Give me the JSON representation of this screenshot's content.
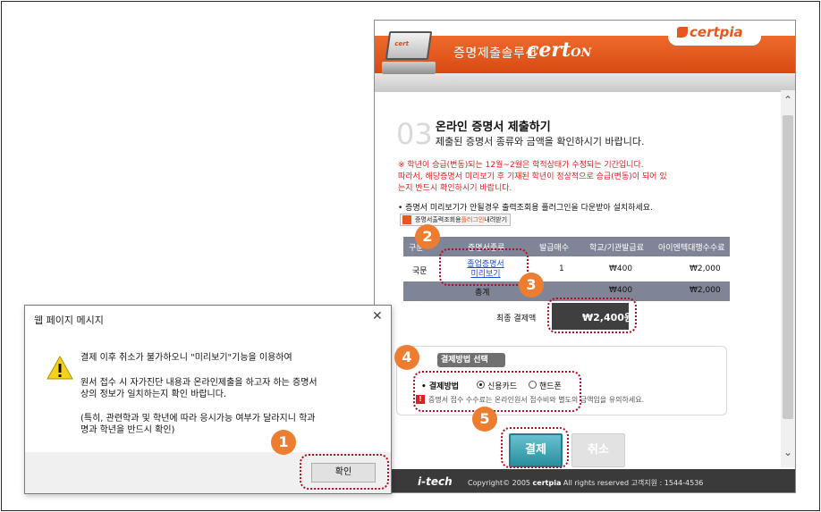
{
  "web": {
    "solution_title": "증명제출솔루션",
    "brand": "cert",
    "brand_b": "ON",
    "cp_logo": "certpia",
    "step_number": "03.",
    "step_title": "온라인 증명서 제출하기",
    "step_desc": "제출된 증명서 종류와 금액을 확인하시기 바랍니다.",
    "notice_red": [
      "※ 학년이 승급(변동)되는 12월~2월은 학적상태가 수정되는 기간입니다.",
      "따라서, 해당증명서 미리보기 후 기재된 학년이 정상적으로 승급(변동)이 되어 있",
      "는지 반드시 확인하시기 바랍니다."
    ],
    "notice_install": "• 증명서 미리보기가 안될경우 출력조회용 플러그인을 다운받아 설치하세요.",
    "plugin_btn_pre": "증명서출력조회용",
    "plugin_btn_hl": "플러그인",
    "plugin_btn_post": "내려받기",
    "table": {
      "headers": [
        "구분",
        "증명서종류",
        "발급매수",
        "학교/기관발급료",
        "아이엔텍대행수수료"
      ],
      "row": {
        "type": "국문",
        "link_line1": "졸업증명서",
        "link_line2": "미리보기",
        "count": "1",
        "school_fee": "₩400",
        "agent_fee": "₩2,000"
      },
      "total": {
        "label": "총계",
        "school_fee": "₩400",
        "agent_fee": "₩2,000"
      }
    },
    "final_label": "최종 결제액",
    "final_value": "₩2,400원",
    "payment": {
      "tab": "결제방법 선택",
      "label": "• 결제방법",
      "opt1": "신용카드",
      "opt2": "핸드폰",
      "note": "증명서 접수 수수료는 온라인원서 접수비와 별도의 금액임을 유의하세요."
    },
    "btn_pay": "결제",
    "btn_cancel": "취소",
    "footer_logo": "i-tech",
    "footer_copy": "Copyright© 2005",
    "footer_brand": "certpia",
    "footer_rights": "All rights reserved  고객지원 : 1544-4536"
  },
  "dialog": {
    "title": "웹 페이지 메시지",
    "line1": "결제 이후 취소가 불가하오니 \"미리보기\"기능을 이용하여",
    "line2": "원서 접수 시 자가진단 내용과 온라인제출을 하고자 하는 증명서",
    "line3": "상의 정보가 일치하는지 확인 바랍니다.",
    "line4": "(특히, 관련학과 및 학년에 따라 응시가능 여부가 달라지니 학과",
    "line5": "명과 학년을 반드시 확인)",
    "ok": "확인"
  },
  "badges": [
    "1",
    "2",
    "3",
    "4",
    "5"
  ],
  "colors": {
    "badge": "#ed7d31",
    "dotted": "#b40f1c",
    "header_orange": "#e8571b",
    "pay_button": "#2a8e9e"
  }
}
